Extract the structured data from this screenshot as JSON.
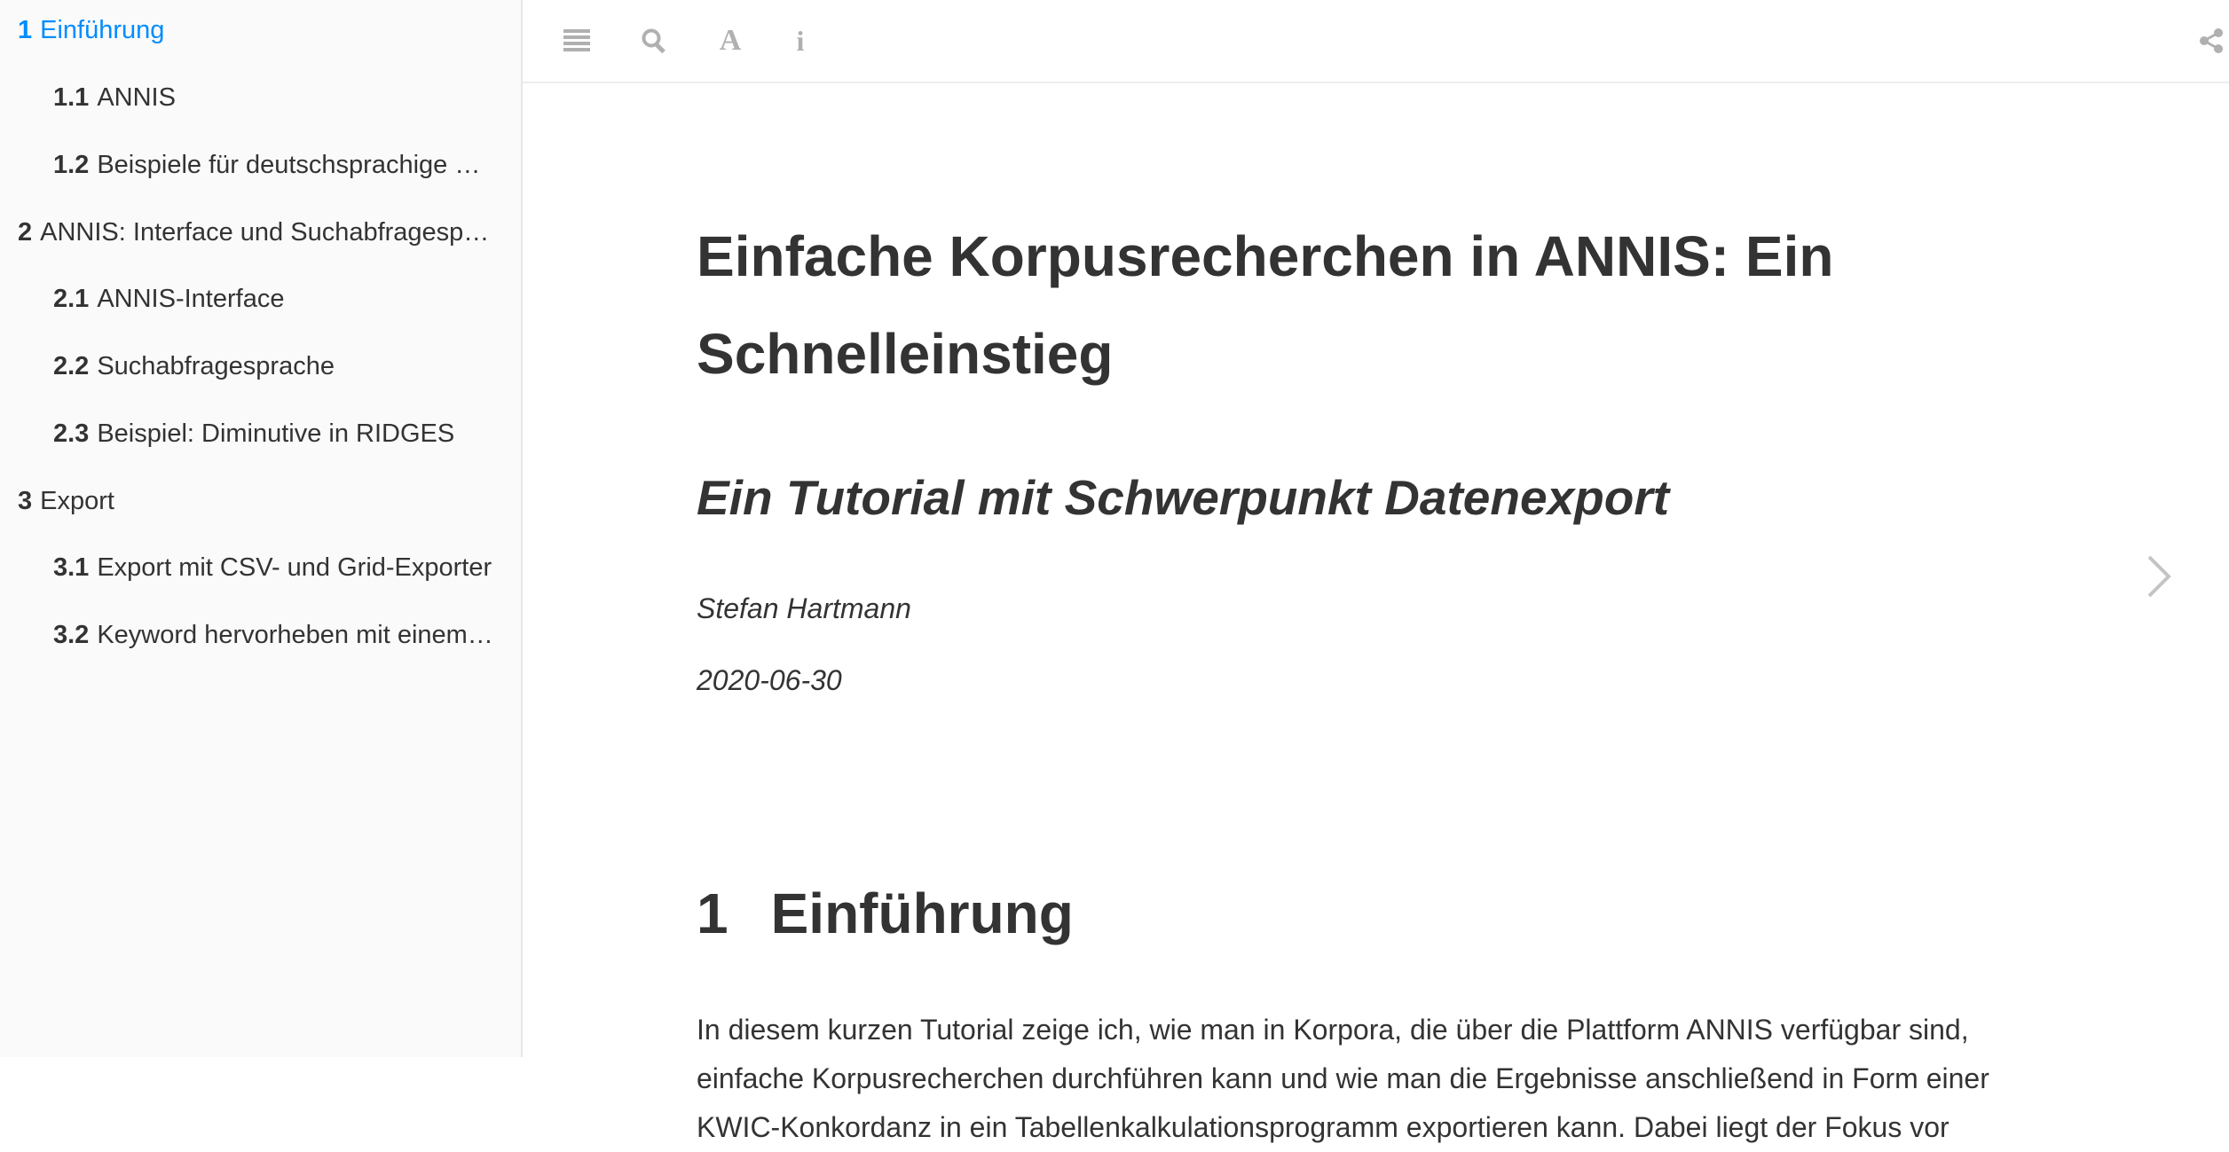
{
  "sidebar": {
    "items": [
      {
        "num": "1",
        "label": "Einführung",
        "active": true
      },
      {
        "num": "1.1",
        "label": "ANNIS"
      },
      {
        "num": "1.2",
        "label": "Beispiele für deutschsprachige …"
      },
      {
        "num": "2",
        "label": "ANNIS: Interface und Suchabfragesp…"
      },
      {
        "num": "2.1",
        "label": "ANNIS-Interface"
      },
      {
        "num": "2.2",
        "label": "Suchabfragesprache"
      },
      {
        "num": "2.3",
        "label": "Beispiel: Diminutive in RIDGES"
      },
      {
        "num": "3",
        "label": "Export"
      },
      {
        "num": "3.1",
        "label": "Export mit CSV- und Grid-Exporter"
      },
      {
        "num": "3.2",
        "label": "Keyword hervorheben mit einem…"
      }
    ]
  },
  "toolbar": {
    "icons": [
      "menu-icon",
      "search-icon",
      "font-icon",
      "info-icon",
      "share-icon"
    ],
    "font_glyph": "A",
    "info_glyph": "i"
  },
  "document": {
    "title": "Einfache Korpusrecherchen in ANNIS: Ein Schnelleinstieg",
    "subtitle": "Ein Tutorial mit Schwerpunkt Datenexport",
    "author": "Stefan Hartmann",
    "date": "2020-06-30",
    "section": {
      "num": "1",
      "title": "Einführung"
    },
    "paragraph": "In diesem kurzen Tutorial zeige ich, wie man in Korpora, die über die Plattform ANNIS verfügbar sind, einfache Korpusrecherchen durchführen kann und wie man die Ergebnisse anschließend in Form einer KWIC-Konkordanz in ein Tabellenkalkulationsprogramm exportieren kann. Dabei liegt der Fokus vor"
  },
  "colors": {
    "accent": "#008cff",
    "text": "#333333",
    "sidebar_bg": "#fafafa",
    "icon": "#b0b0b0"
  }
}
